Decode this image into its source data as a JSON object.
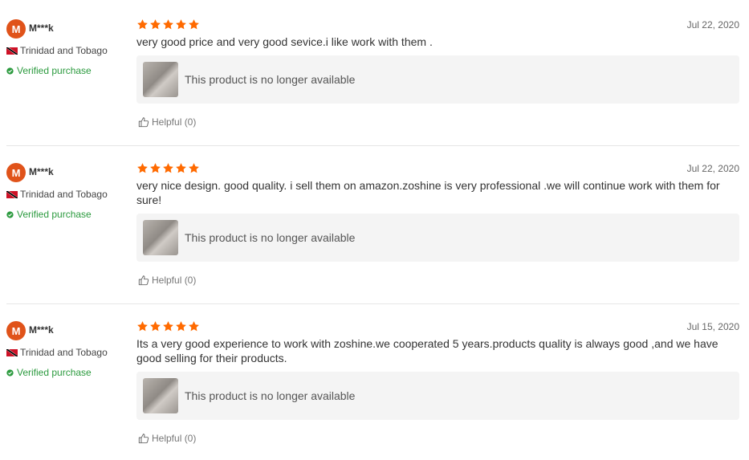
{
  "reviews": [
    {
      "avatar_letter": "M",
      "name": "M***k",
      "country": "Trinidad and Tobago",
      "verified": "Verified purchase",
      "rating": 5,
      "date": "Jul 22, 2020",
      "text": "very good price and very good sevice.i like work with them .",
      "product_label": "This product is no longer available",
      "helpful": "Helpful (0)"
    },
    {
      "avatar_letter": "M",
      "name": "M***k",
      "country": "Trinidad and Tobago",
      "verified": "Verified purchase",
      "rating": 5,
      "date": "Jul 22, 2020",
      "text": "very nice design. good quality. i sell them on amazon.zoshine is very professional .we will continue work with them for sure!",
      "product_label": "This product is no longer available",
      "helpful": "Helpful (0)"
    },
    {
      "avatar_letter": "M",
      "name": "M***k",
      "country": "Trinidad and Tobago",
      "verified": "Verified purchase",
      "rating": 5,
      "date": "Jul 15, 2020",
      "text": "Its a very good experience to work with zoshine.we cooperated 5 years.products quality is always good ,and we have good selling for their products.",
      "product_label": "This product is no longer available",
      "helpful": "Helpful (0)"
    }
  ],
  "colors": {
    "star": "#ff6a00",
    "avatar": "#e0531a",
    "verified": "#2b9a3e"
  },
  "icons": {
    "star": "star-icon",
    "verified": "verified-badge-icon",
    "helpful": "thumbs-up-icon",
    "flag": "trinidad-and-tobago-flag-icon"
  }
}
